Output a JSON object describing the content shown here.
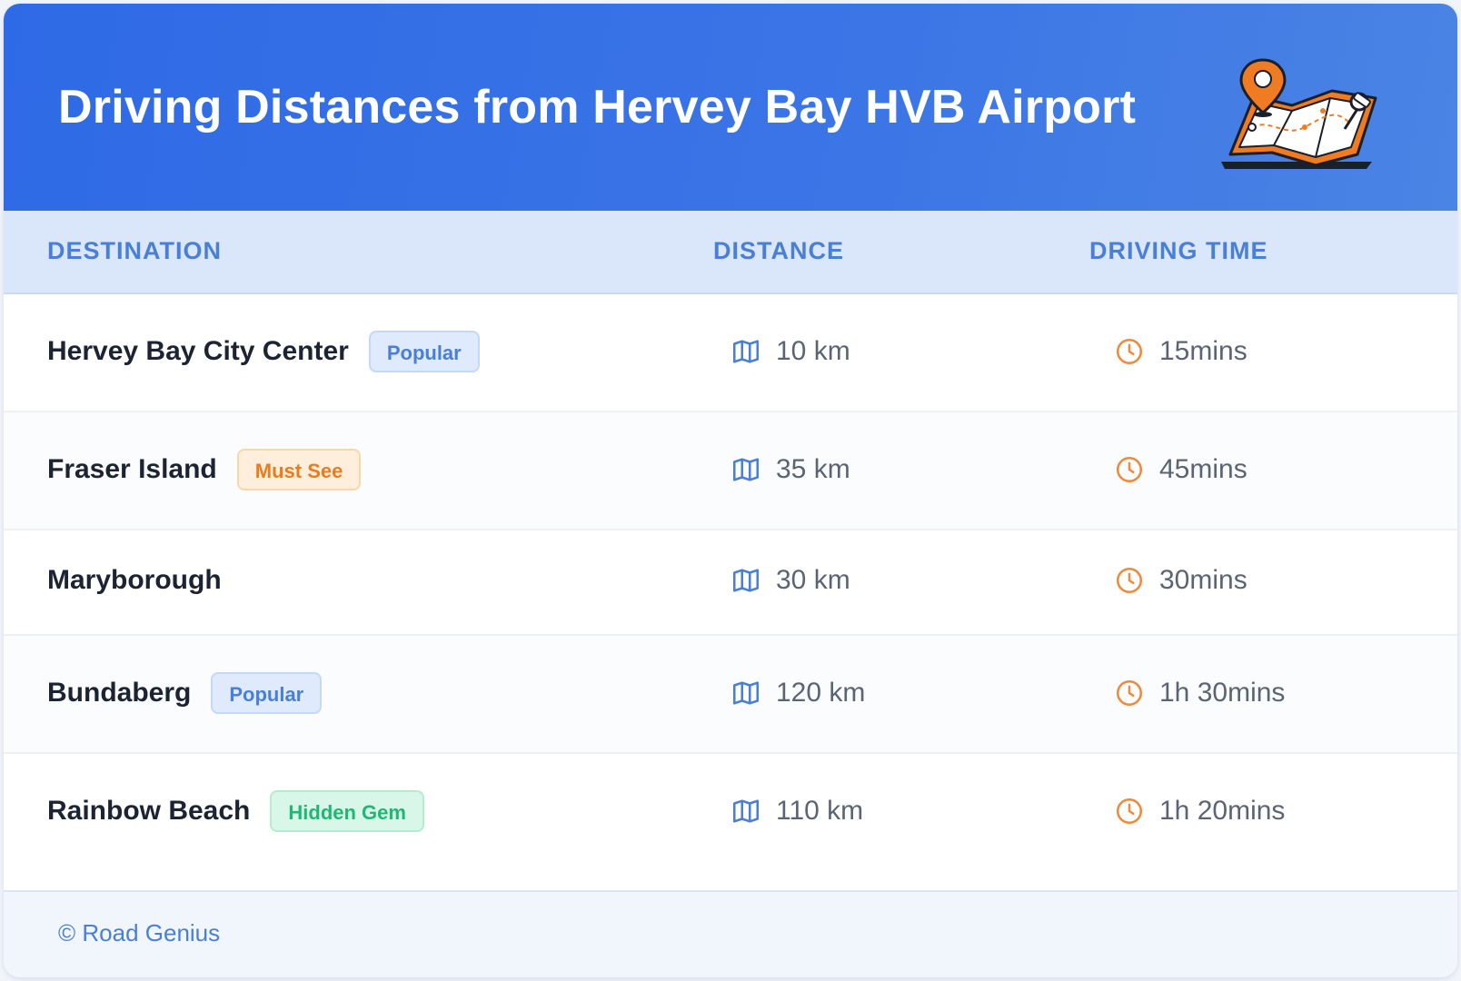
{
  "header": {
    "title": "Driving Distances from Hervey Bay HVB Airport",
    "illustration_icon": "map-pin-illustration"
  },
  "table": {
    "columns": [
      "DESTINATION",
      "DISTANCE",
      "DRIVING TIME"
    ],
    "rows": [
      {
        "destination": "Hervey Bay City Center",
        "badge": "Popular",
        "badge_color": "blue",
        "distance": "10 km",
        "time": "15mins"
      },
      {
        "destination": "Fraser Island",
        "badge": "Must See",
        "badge_color": "orange",
        "distance": "35 km",
        "time": "45mins"
      },
      {
        "destination": "Maryborough",
        "badge": "",
        "badge_color": "",
        "distance": "30 km",
        "time": "30mins"
      },
      {
        "destination": "Bundaberg",
        "badge": "Popular",
        "badge_color": "blue",
        "distance": "120 km",
        "time": "1h 30mins"
      },
      {
        "destination": "Rainbow Beach",
        "badge": "Hidden Gem",
        "badge_color": "green",
        "distance": "110 km",
        "time": "1h 20mins"
      }
    ],
    "distance_icon": "map-icon",
    "time_icon": "clock-icon"
  },
  "footer": {
    "copyright": "© Road Genius"
  },
  "colors": {
    "header_start": "#2f6ae6",
    "header_end": "#4a84e4",
    "accent_blue": "#4a7fd6",
    "accent_orange": "#ec7b1d",
    "accent_green": "#1db874"
  }
}
